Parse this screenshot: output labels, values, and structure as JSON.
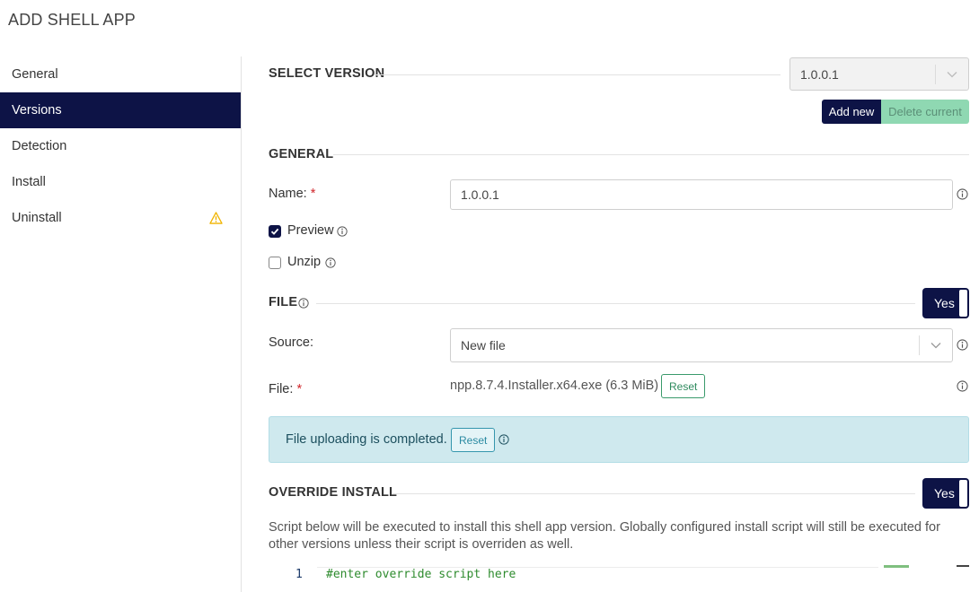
{
  "page": {
    "title": "ADD SHELL APP"
  },
  "sidebar": {
    "items": [
      {
        "label": "General"
      },
      {
        "label": "Versions"
      },
      {
        "label": "Detection"
      },
      {
        "label": "Install"
      },
      {
        "label": "Uninstall"
      }
    ],
    "active_index": 1
  },
  "select_version": {
    "heading": "SELECT VERSION",
    "selected": "1.0.0.1",
    "add_label": "Add new",
    "delete_label": "Delete current"
  },
  "general": {
    "heading": "GENERAL",
    "name_label": "Name:",
    "required_mark": "*",
    "name_value": "1.0.0.1",
    "preview_label": "Preview",
    "preview_checked": true,
    "unzip_label": "Unzip",
    "unzip_checked": false
  },
  "file": {
    "heading": "FILE",
    "toggle_label": "Yes",
    "source_label": "Source:",
    "source_value": "New file",
    "file_label": "File:",
    "required_mark": "*",
    "file_name": "npp.8.7.4.Installer.x64.exe (6.3 MiB)",
    "reset_label": "Reset",
    "upload_message": "File uploading is completed.",
    "upload_reset_label": "Reset"
  },
  "override_install": {
    "heading": "OVERRIDE INSTALL",
    "toggle_label": "Yes",
    "description": "Script below will be executed to install this shell app version. Globally configured install script will still be executed for other versions unless their script is overriden as well.",
    "code_line_number": "1",
    "code_text": "#enter override script here"
  },
  "colors": {
    "accent": "#0d1346",
    "required": "#d0262b",
    "warning": "#f0b400",
    "alert_bg": "#cfe9ee",
    "delete_bg": "#8fd8b2"
  },
  "icons": {
    "warning": "warning-triangle-icon",
    "info": "info-icon",
    "chevron": "chevron-down-icon",
    "check": "check-icon"
  }
}
